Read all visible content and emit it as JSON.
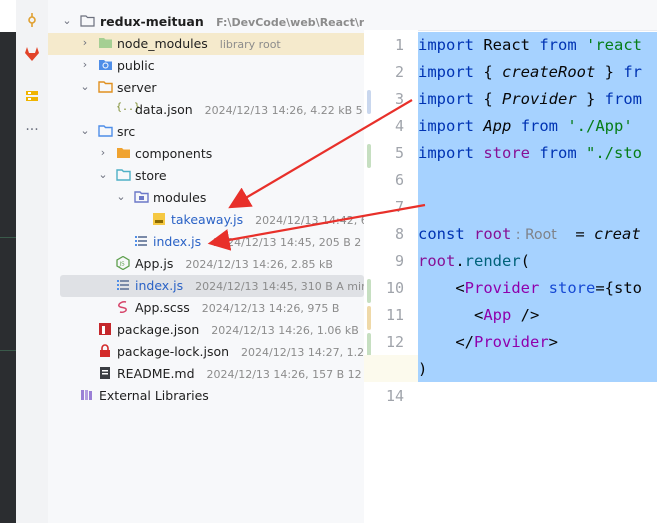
{
  "project": {
    "name": "redux-meituan",
    "path": "F:\\DevCode\\web\\React\\redux-"
  },
  "tree": [
    {
      "name": "node_modules",
      "meta": "library root"
    },
    {
      "name": "public",
      "meta": ""
    },
    {
      "name": "server",
      "meta": ""
    },
    {
      "name": "data.json",
      "meta": "2024/12/13 14:26, 4.22 kB 5 minu"
    },
    {
      "name": "src",
      "meta": ""
    },
    {
      "name": "components",
      "meta": ""
    },
    {
      "name": "store",
      "meta": ""
    },
    {
      "name": "modules",
      "meta": ""
    },
    {
      "name": "takeaway.js",
      "meta": "2024/12/13 14:42, 684 B"
    },
    {
      "name": "index.js",
      "meta": "2024/12/13 14:45, 205 B 2 minu"
    },
    {
      "name": "App.js",
      "meta": "2024/12/13 14:26, 2.85 kB"
    },
    {
      "name": "index.js",
      "meta": "2024/12/13 14:45, 310 B A minute"
    },
    {
      "name": "App.scss",
      "meta": "2024/12/13 14:26, 975 B"
    },
    {
      "name": "package.json",
      "meta": "2024/12/13 14:26, 1.06 kB"
    },
    {
      "name": "package-lock.json",
      "meta": "2024/12/13 14:27, 1.27 ME"
    },
    {
      "name": "README.md",
      "meta": "2024/12/13 14:26, 157 B 12 minu"
    },
    {
      "name": "External Libraries",
      "meta": ""
    }
  ],
  "editor": {
    "line_numbers": [
      "1",
      "2",
      "3",
      "4",
      "5",
      "6",
      "7",
      "8",
      "9",
      "10",
      "11",
      "12",
      "13",
      "14"
    ],
    "lines": {
      "l1": {
        "kw": "import",
        "a": " React ",
        "kw2": "from",
        "str": " 'react"
      },
      "l2": {
        "kw": "import",
        "a": " { ",
        "it": "createRoot",
        "b": " } ",
        "kw2": "fr"
      },
      "l3": {
        "kw": "import",
        "a": " { ",
        "it": "Provider",
        "b": " } ",
        "kw2": "from"
      },
      "l4": {
        "kw": "import",
        "a": " ",
        "it": "App",
        "b": " ",
        "kw2": "from",
        "str": " './App'"
      },
      "l5": {
        "kw": "import",
        "a": " ",
        "v": "store",
        "b": " ",
        "kw2": "from",
        "str": " \"./sto"
      },
      "l8": {
        "kw": "const",
        "v": " root",
        "hint": " : Root",
        "a": "  = ",
        "it": "creat"
      },
      "l9": {
        "v": "root",
        "a": ".",
        "fn": "render",
        "b": "("
      },
      "l10": {
        "a": "    <",
        "tag": "Provider",
        "b": " ",
        "attr": "store",
        "c": "={sto"
      },
      "l11": {
        "a": "      <",
        "tag": "App",
        "b": " />"
      },
      "l12": {
        "a": "    </",
        "tag": "Provider",
        "b": ">"
      },
      "l13": {
        "a": ")"
      }
    }
  },
  "colors": {
    "selection": "#a6d2ff",
    "annotation_arrow": "#e8302a",
    "keyword": "#0033b3",
    "string": "#067d17"
  }
}
